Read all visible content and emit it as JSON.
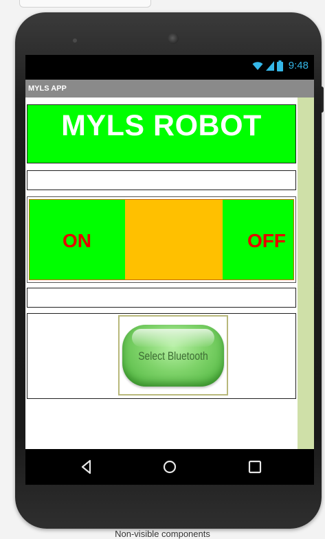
{
  "statusbar": {
    "time": "9:48",
    "icons": [
      "wifi-icon",
      "signal-icon",
      "battery-icon"
    ]
  },
  "app": {
    "title": "MYLS APP"
  },
  "main": {
    "heading": "MYLS ROBOT",
    "on_label": "ON",
    "off_label": "OFF",
    "bluetooth_button_label": "Select Bluetooth"
  },
  "navbar": {
    "icons": [
      "back-icon",
      "home-icon",
      "recents-icon"
    ]
  },
  "footer": {
    "label": "Non-visible components"
  },
  "colors": {
    "title_panel_bg": "#00ff00",
    "control_on_off_bg": "#00ff00",
    "control_middle_bg": "#ffc000",
    "control_text": "#e60000",
    "statusbar_accent": "#35b7e8",
    "titlebar_bg": "#8a8a8a"
  }
}
